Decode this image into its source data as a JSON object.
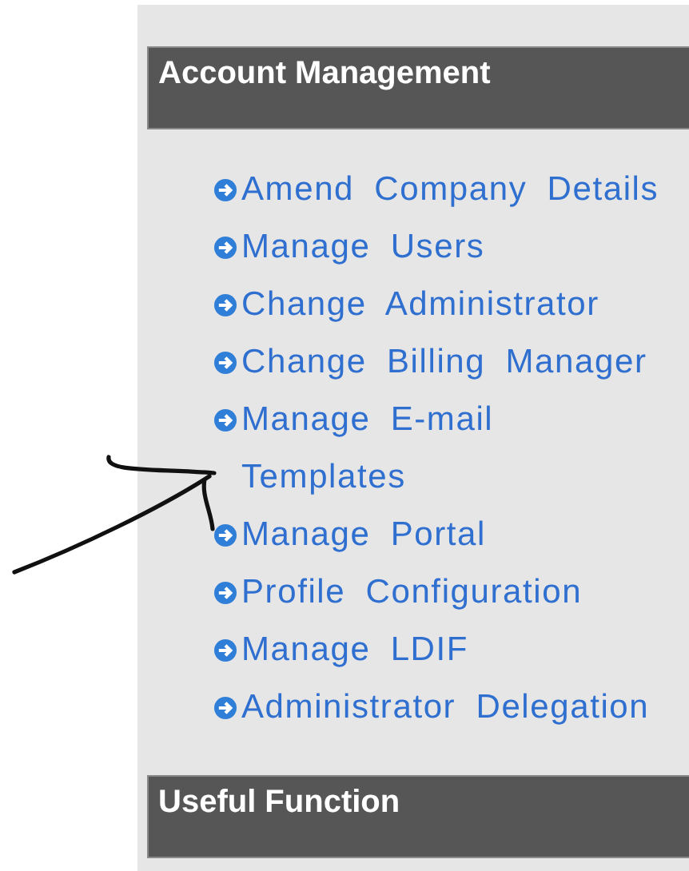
{
  "sections": [
    {
      "title": "Account Management",
      "links": [
        {
          "label": "Amend Company Details"
        },
        {
          "label": "Manage Users"
        },
        {
          "label": "Change Administrator"
        },
        {
          "label": "Change Billing Manager"
        },
        {
          "label": "Manage E-mail Templates"
        },
        {
          "label": "Manage Portal"
        },
        {
          "label": "Profile Configuration"
        },
        {
          "label": "Manage LDIF"
        },
        {
          "label": "Administrator Delegation"
        }
      ]
    },
    {
      "title": "Useful Function"
    }
  ]
}
